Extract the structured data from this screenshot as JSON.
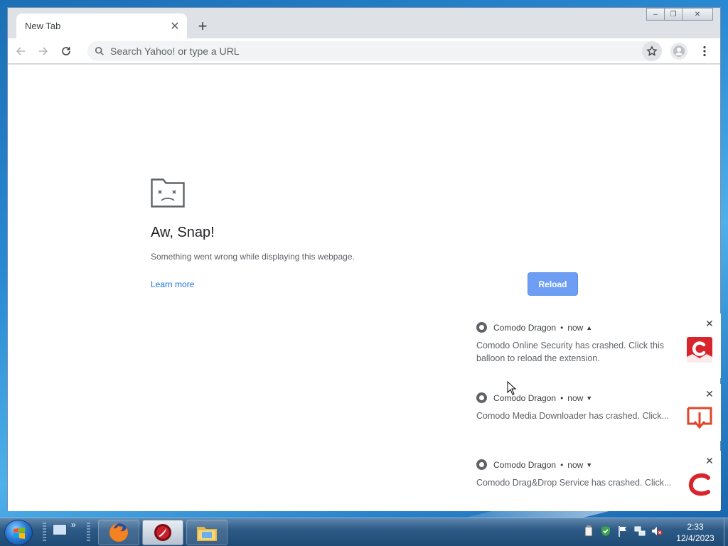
{
  "browser": {
    "tab_title": "New Tab",
    "omnibox_placeholder": "Search Yahoo! or type a URL"
  },
  "error_page": {
    "title": "Aw, Snap!",
    "description": "Something went wrong while displaying this webpage.",
    "learn_more": "Learn more",
    "reload_label": "Reload"
  },
  "notifications": [
    {
      "app": "Comodo Dragon",
      "time": "now",
      "message": "Comodo Online Security has crashed. Click this balloon to reload the extension.",
      "icon": "comodo-shield-icon",
      "expanded": true
    },
    {
      "app": "Comodo Dragon",
      "time": "now",
      "message": "Comodo Media Downloader has crashed. Click...",
      "icon": "download-icon",
      "expanded": false
    },
    {
      "app": "Comodo Dragon",
      "time": "now",
      "message": "Comodo Drag&Drop Service has crashed. Click...",
      "icon": "comodo-c-icon",
      "expanded": false
    }
  ],
  "taskbar": {
    "time": "2:33",
    "date": "12/4/2023",
    "apps": [
      "firefox-icon",
      "comodo-dragon-icon",
      "file-explorer-icon"
    ]
  },
  "colors": {
    "reload_button": "#6e9ef3",
    "link": "#1a73e8",
    "comodo_red": "#d9242b"
  }
}
